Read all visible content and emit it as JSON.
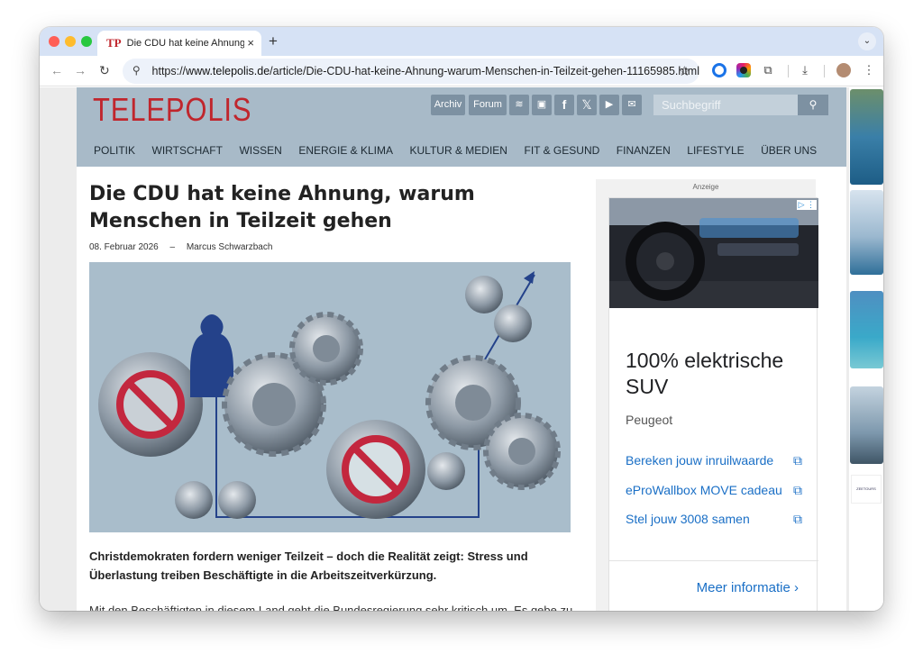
{
  "browser": {
    "tab_title": "Die CDU hat keine Ahnung, w",
    "tab_favicon": "TP",
    "new_tab": "+",
    "close": "×",
    "url_prefix": "https://",
    "url_domain": "www.telepolis.de",
    "url_path": "/article/Die-CDU-hat-keine-Ahnung-warum-Menschen-in-Teilzeit-gehen-11165985.html"
  },
  "site": {
    "logo": "TELEPOLIS",
    "header_buttons": [
      "Archiv",
      "Forum"
    ],
    "search_placeholder": "Suchbegriff",
    "nav": [
      "POLITIK",
      "WIRTSCHAFT",
      "WISSEN",
      "ENERGIE & KLIMA",
      "KULTUR & MEDIEN",
      "FIT & GESUND",
      "FINANZEN",
      "LIFESTYLE",
      "ÜBER UNS"
    ]
  },
  "article": {
    "headline": "Die CDU hat keine Ahnung, warum Menschen in Teilzeit gehen",
    "date": "08. Februar 2026",
    "separator": "–",
    "author": "Marcus Schwarzbach",
    "lead": "Christdemokraten fordern weniger Teilzeit – doch die Realität zeigt: Stress und Überlastung treiben Beschäftigte in die Arbeitszeitverkürzung.",
    "body_start": "Mit den Beschäftigten in diesem Land geht die Bundesregierung sehr kritisch um. Es gebe zu"
  },
  "ad": {
    "label": "Anzeige",
    "title": "100% elektrische SUV",
    "brand": "Peugeot",
    "links": [
      "Bereken jouw inruilwaarde",
      "eProWallbox MOVE cadeau",
      "Stel jouw 3008 samen"
    ],
    "more": "Meer informatie"
  },
  "sidebar_ad": {
    "brand": "ZEETOURS"
  },
  "colors": {
    "header_bg": "#a8bac8",
    "logo_red": "#c0262d",
    "link_blue": "#1a6fc6",
    "tab_bar": "#d6e2f5"
  }
}
